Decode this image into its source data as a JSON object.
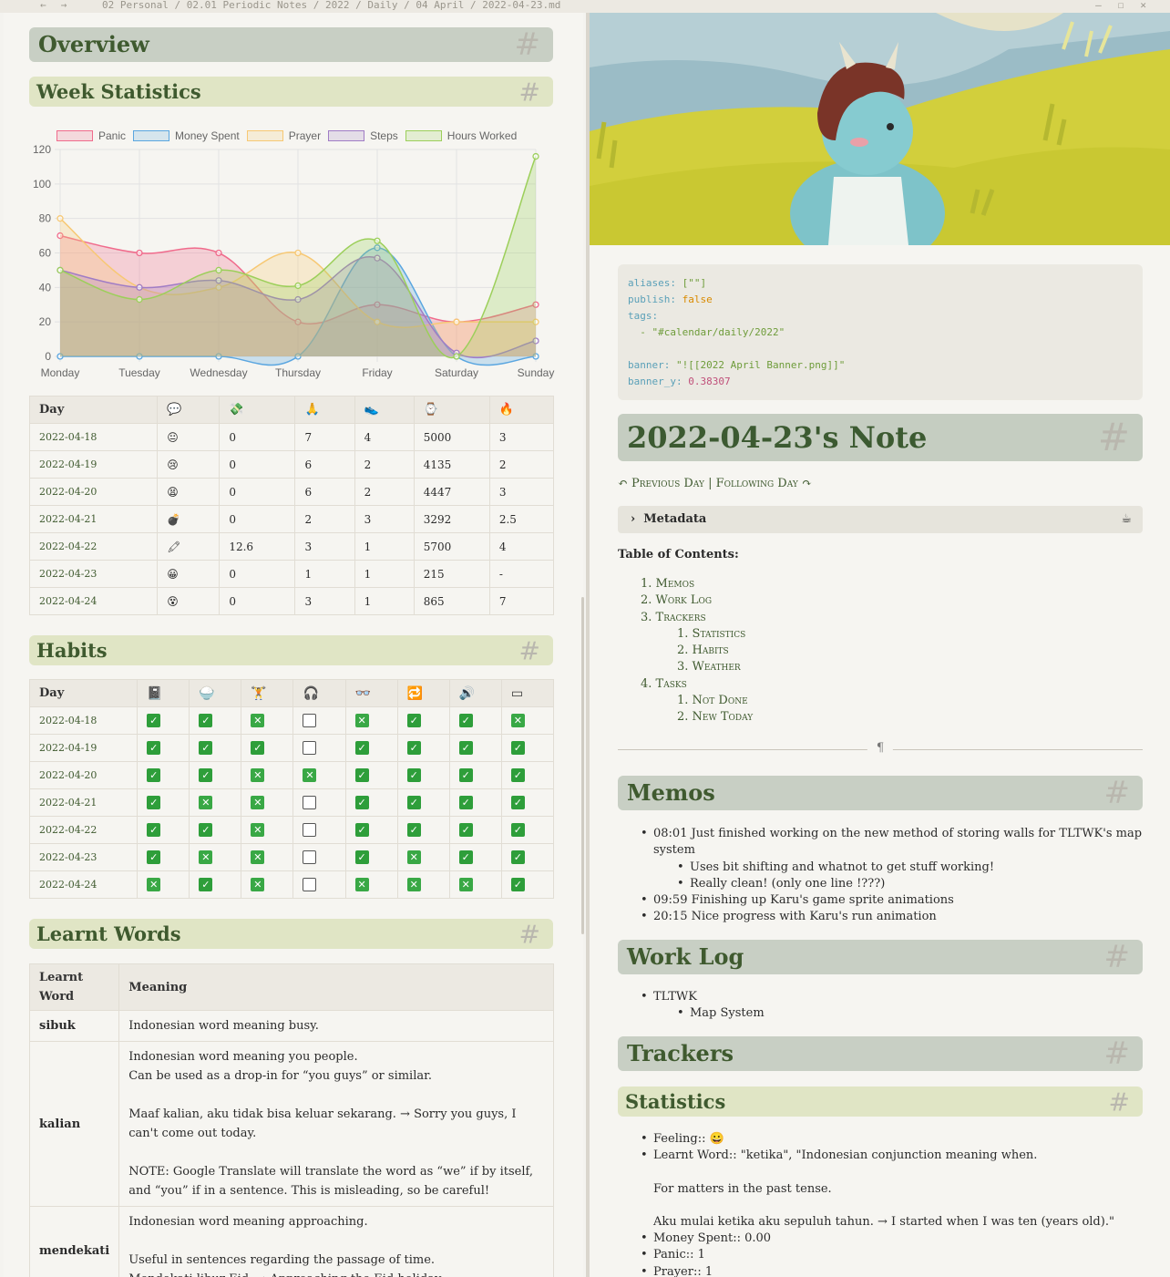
{
  "titlebar": {
    "back": "←",
    "forward": "→",
    "breadcrumb": "02 Personal / 02.01 Periodic Notes / 2022 / Daily / 04 April / 2022-04-23.md",
    "minimize": "—",
    "maximize": "☐",
    "close": "✕"
  },
  "left": {
    "overview_title": "Overview",
    "week_stats_title": "Week Statistics",
    "habits_title": "Habits",
    "learnt_words_title": "Learnt Words",
    "hash": "#",
    "stats_table": {
      "headers": [
        "Day",
        "💬",
        "💸",
        "🙏",
        "👟",
        "⌚",
        "🔥",
        "✏"
      ],
      "rows": [
        [
          "2022-04-18",
          "😐",
          "0",
          "7",
          "4",
          "5000",
          "3"
        ],
        [
          "2022-04-19",
          "😢",
          "0",
          "6",
          "2",
          "4135",
          "2"
        ],
        [
          "2022-04-20",
          "😫",
          "0",
          "6",
          "2",
          "4447",
          "3"
        ],
        [
          "2022-04-21",
          "💣",
          "0",
          "2",
          "3",
          "3292",
          "2.5"
        ],
        [
          "2022-04-22",
          "🖍",
          "12.6",
          "3",
          "1",
          "5700",
          "4"
        ],
        [
          "2022-04-23",
          "😀",
          "0",
          "1",
          "1",
          "215",
          "-"
        ],
        [
          "2022-04-24",
          "😵",
          "0",
          "3",
          "1",
          "865",
          "7"
        ]
      ]
    },
    "habits_table": {
      "headers": [
        "Day",
        "📓",
        "🍚",
        "🏋",
        "🎧",
        "👓",
        "🔁",
        "🔊",
        "▭"
      ],
      "rows": [
        [
          "2022-04-18",
          "c",
          "c",
          "x",
          "e",
          "x",
          "c",
          "c",
          "x"
        ],
        [
          "2022-04-19",
          "c",
          "c",
          "c",
          "e",
          "c",
          "c",
          "c",
          "c"
        ],
        [
          "2022-04-20",
          "c",
          "c",
          "x",
          "x",
          "c",
          "c",
          "c",
          "c"
        ],
        [
          "2022-04-21",
          "c",
          "x",
          "x",
          "e",
          "c",
          "c",
          "c",
          "c"
        ],
        [
          "2022-04-22",
          "c",
          "c",
          "x",
          "e",
          "c",
          "c",
          "c",
          "c"
        ],
        [
          "2022-04-23",
          "c",
          "x",
          "x",
          "e",
          "c",
          "x",
          "c",
          "c"
        ],
        [
          "2022-04-24",
          "x",
          "c",
          "x",
          "e",
          "x",
          "x",
          "x",
          "c"
        ]
      ],
      "check_glyph": "✓",
      "cross_glyph": "✕"
    },
    "words_table": {
      "headers": [
        "Learnt Word",
        "Meaning"
      ],
      "rows": [
        {
          "word": "sibuk",
          "lines": [
            "Indonesian word meaning busy."
          ]
        },
        {
          "word": "kalian",
          "lines": [
            "Indonesian word meaning you people.",
            "Can be used as a drop-in for “you guys” or similar.",
            "",
            "Maaf kalian, aku tidak bisa keluar sekarang. → Sorry you guys, I can't come out today.",
            "",
            "NOTE: Google Translate will translate the word as “we” if by itself, and “you” if in a sentence. This is misleading, so be careful!"
          ]
        },
        {
          "word": "mendekati",
          "lines": [
            "Indonesian word meaning approaching.",
            "",
            "Useful in sentences regarding the passage of time.",
            "Mendekati libur Eid. → Approaching the Eid holiday."
          ]
        }
      ]
    }
  },
  "chart_data": {
    "type": "line",
    "categories": [
      "Monday",
      "Tuesday",
      "Wednesday",
      "Thursday",
      "Friday",
      "Saturday",
      "Sunday"
    ],
    "series": [
      {
        "name": "Panic",
        "color": "#f06b8c",
        "values": [
          70,
          60,
          60,
          20,
          30,
          20,
          30
        ]
      },
      {
        "name": "Money Spent",
        "color": "#5aa6e0",
        "values": [
          0,
          0,
          0,
          0,
          63,
          0,
          0
        ]
      },
      {
        "name": "Prayer",
        "color": "#f7c873",
        "values": [
          80,
          40,
          40,
          60,
          20,
          20,
          20
        ]
      },
      {
        "name": "Steps",
        "color": "#a07cc5",
        "values": [
          50,
          40,
          44,
          33,
          57,
          2,
          9
        ]
      },
      {
        "name": "Hours Worked",
        "color": "#9ccf5a",
        "values": [
          50,
          33,
          50,
          41,
          67,
          0,
          116
        ]
      }
    ],
    "ylim": [
      0,
      120
    ],
    "yticks": [
      "0",
      "20",
      "40",
      "60",
      "80",
      "100",
      "120"
    ],
    "grid": true,
    "legend": "top"
  },
  "right": {
    "frontmatter": {
      "aliases_key": "aliases:",
      "aliases_val": "[\"\"]",
      "publish_key": "publish:",
      "publish_val": "false",
      "tags_key": "tags:",
      "tags_val": "- \"#calendar/daily/2022\"",
      "banner_key": "banner:",
      "banner_val": "\"![[2022 April Banner.png]]\"",
      "banner_y_key": "banner_y:",
      "banner_y_val": "0.38307"
    },
    "note_title": "2022-04-23's Note",
    "nav": "↶ Previous Day | Following Day ↷",
    "metadata_label": "Metadata",
    "metadata_icon": "☕",
    "toc_title": "Table of Contents:",
    "toc": [
      "1. Memos",
      "2. Work Log",
      "3. Trackers",
      "1. Statistics",
      "2. Habits",
      "3. Weather",
      "4. Tasks",
      "1. Not Done",
      "2. New Today"
    ],
    "separator": "¶",
    "memos_title": "Memos",
    "memos": [
      "08:01 Just finished working on the new method of storing walls for TLTWK's map",
      "system",
      "Uses bit shifting and whatnot to get stuff working!",
      "Really clean! (only one line !???)",
      "09:59 Finishing up Karu's game sprite animations",
      "20:15 Nice progress with Karu's run animation"
    ],
    "worklog_title": "Work Log",
    "worklog": [
      "TLTWK",
      "Map System"
    ],
    "trackers_title": "Trackers",
    "statistics_title": "Statistics",
    "stats": [
      "Feeling:: 😀",
      "Learnt Word:: \"ketika\", \"Indonesian conjunction meaning when.",
      "For matters in the past tense.",
      "Aku mulai ketika aku sepuluh tahun. → I started when I was ten (years old).\"",
      "Money Spent:: 0.00",
      "Panic:: 1",
      "Prayer:: 1"
    ]
  }
}
